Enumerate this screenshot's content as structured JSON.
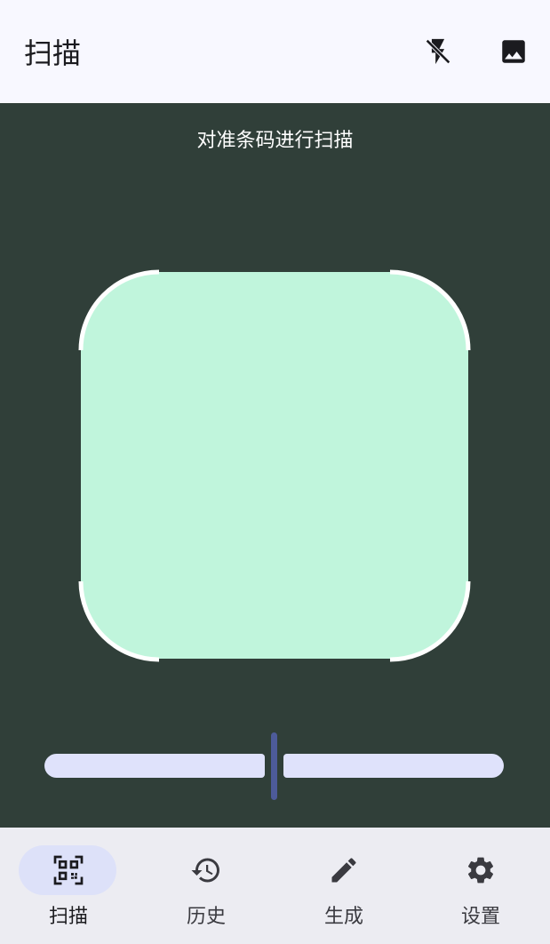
{
  "header": {
    "title": "扫描",
    "actions": [
      {
        "name": "flash-off-icon"
      },
      {
        "name": "image-icon"
      }
    ]
  },
  "camera": {
    "hint": "对准条码进行扫描",
    "zoom_level": 0.5
  },
  "nav": {
    "items": [
      {
        "label": "扫描",
        "icon": "qr-scan-icon",
        "active": true
      },
      {
        "label": "历史",
        "icon": "history-icon",
        "active": false
      },
      {
        "label": "生成",
        "icon": "pencil-icon",
        "active": false
      },
      {
        "label": "设置",
        "icon": "gear-icon",
        "active": false
      }
    ]
  },
  "colors": {
    "app_bar": "#f8f8ff",
    "camera_bg": "#303f39",
    "scan_window": "#c0f5dc",
    "slider_track": "#dfe2fb",
    "slider_thumb": "#4d5b9a",
    "nav_bg": "#ececf2",
    "nav_active_pill": "#dde1f9"
  }
}
